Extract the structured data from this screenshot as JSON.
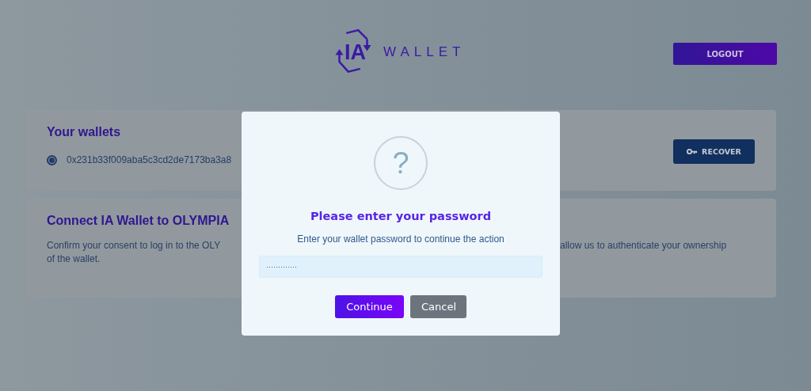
{
  "header": {
    "logo": {
      "mark": "IA",
      "word": "WALLET"
    },
    "logout_button": "LOGOUT"
  },
  "wallets_card": {
    "title": "Your wallets",
    "wallets": [
      {
        "address": "0x231b33f009aba5c3cd2de7173ba3a8",
        "selected": true
      }
    ],
    "recover_button": "RECOVER"
  },
  "connect_card": {
    "title": "Connect IA Wallet to OLYMPIA",
    "text_left": "Confirm your consent to log in to the OLY",
    "text_right": "allow us to authenticate your ownership",
    "text_line_2": "of the wallet."
  },
  "dialog": {
    "icon": "?",
    "title": "Please enter your password",
    "message": "Enter your wallet password to continue the action",
    "password": {
      "value": "·············"
    },
    "buttons": [
      {
        "label": "Continue",
        "kind": "primary"
      },
      {
        "label": "Cancel",
        "kind": "secondary"
      }
    ]
  }
}
